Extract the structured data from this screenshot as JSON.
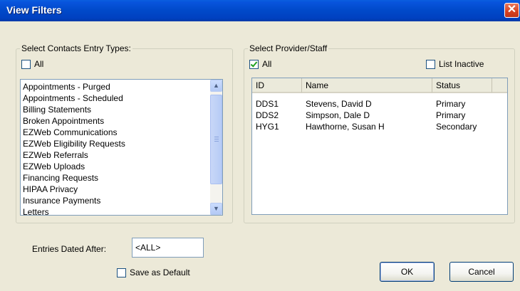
{
  "window": {
    "title": "View Filters",
    "close_symbol": "✕"
  },
  "contacts_group": {
    "legend": "Select Contacts Entry Types:",
    "all_label": "All",
    "all_checked": false,
    "items": [
      "Appointments - Purged",
      "Appointments - Scheduled",
      "Billing Statements",
      "Broken Appointments",
      "EZWeb Communications",
      "EZWeb Eligibility Requests",
      "EZWeb Referrals",
      "EZWeb Uploads",
      "Financing Requests",
      "HIPAA Privacy",
      "Insurance Payments",
      "Letters"
    ]
  },
  "provider_group": {
    "legend": "Select Provider/Staff",
    "all_label": "All",
    "all_checked": true,
    "list_inactive_label": "List Inactive",
    "list_inactive_checked": false,
    "columns": [
      "ID",
      "Name",
      "Status"
    ],
    "rows": [
      {
        "id": "DDS1",
        "name": "Stevens, David D",
        "status": "Primary"
      },
      {
        "id": "DDS2",
        "name": "Simpson, Dale D",
        "status": "Primary"
      },
      {
        "id": "HYG1",
        "name": "Hawthorne, Susan H",
        "status": "Secondary"
      }
    ]
  },
  "entries_dated_after": {
    "label": "Entries Dated After:",
    "value": "<ALL>"
  },
  "save_default": {
    "label": "Save as Default",
    "checked": false
  },
  "buttons": {
    "ok": "OK",
    "cancel": "Cancel"
  },
  "colors": {
    "title_bar": "#0049c9",
    "dialog_bg": "#ece9d8",
    "close_button": "#d6401f"
  }
}
